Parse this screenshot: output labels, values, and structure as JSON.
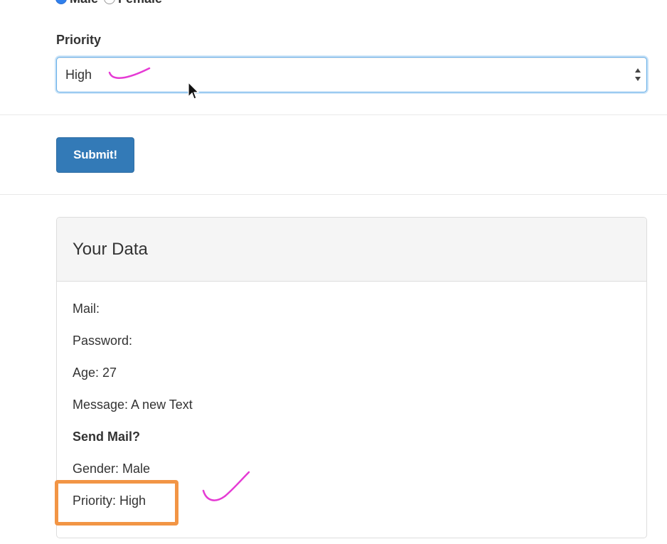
{
  "form": {
    "gender_options": [
      "Male",
      "Female"
    ],
    "gender_selected": "Male",
    "priority_label": "Priority",
    "priority_value": "High",
    "submit_label": "Submit!"
  },
  "output_panel": {
    "title": "Your Data",
    "rows": [
      "Mail:",
      "Password:",
      "Age: 27",
      "Message: A new Text",
      "Send Mail?",
      "Gender: Male",
      "Priority: High"
    ]
  },
  "colors": {
    "primary": "#337ab7",
    "focus_border": "#66afe9",
    "annotation_pink": "#e53ad4",
    "highlight_orange": "#f29545"
  },
  "icons": {
    "select_arrows": "sort-arrows-icon",
    "cursor": "mouse-pointer-icon"
  }
}
